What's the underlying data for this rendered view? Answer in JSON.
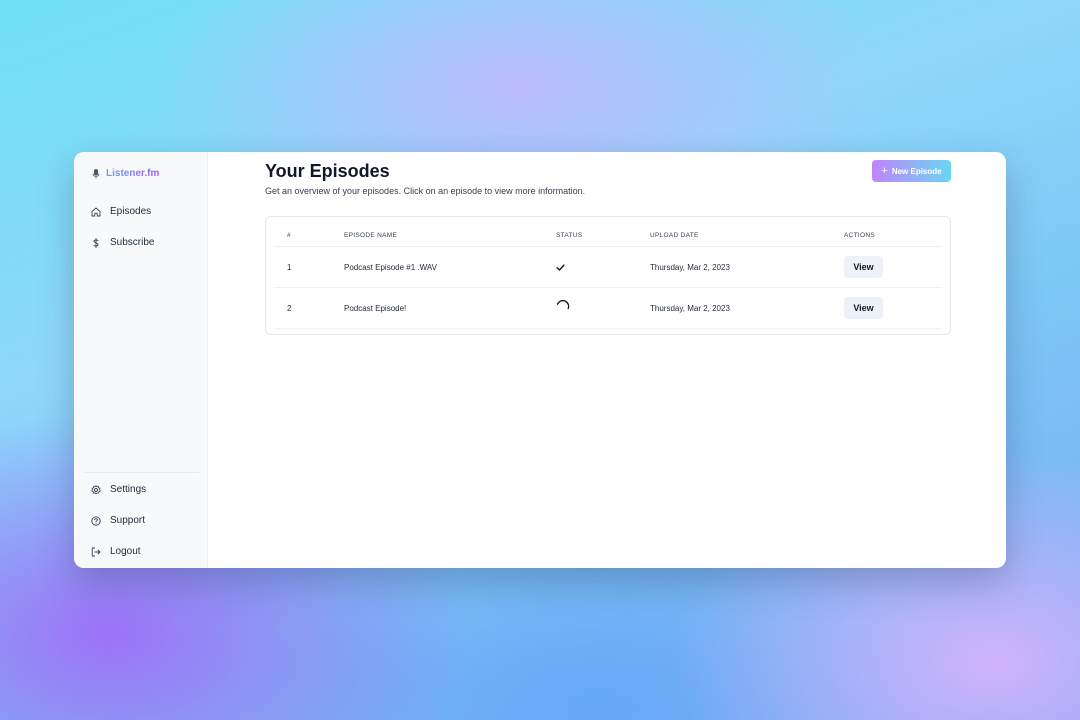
{
  "app": {
    "brand_name": "Listener.fm"
  },
  "sidebar": {
    "top_items": [
      {
        "label": "Episodes",
        "icon": "home-icon"
      },
      {
        "label": "Subscribe",
        "icon": "dollar-icon"
      }
    ],
    "bottom_items": [
      {
        "label": "Settings",
        "icon": "gear-icon"
      },
      {
        "label": "Support",
        "icon": "help-circle-icon"
      },
      {
        "label": "Logout",
        "icon": "logout-icon"
      }
    ]
  },
  "header": {
    "title": "Your Episodes",
    "subtitle": "Get an overview of your episodes. Click on an episode to view more information.",
    "new_button_label": "New Episode"
  },
  "table": {
    "columns": [
      "#",
      "EPISODE NAME",
      "STATUS",
      "UPLOAD DATE",
      "ACTIONS"
    ],
    "rows": [
      {
        "num": "1",
        "name": "Podcast Episode #1 .WAV",
        "status": "check-icon",
        "date": "Thursday, Mar 2, 2023",
        "action": "View"
      },
      {
        "num": "2",
        "name": "Podcast Episode!",
        "status": "spinner-icon",
        "date": "Thursday, Mar 2, 2023",
        "action": "View"
      }
    ]
  },
  "colors": {
    "accent_start": "#c084fc",
    "accent_end": "#6ad6f2",
    "brand_gradient_start": "#60a5fa",
    "brand_gradient_end": "#a855f7"
  }
}
